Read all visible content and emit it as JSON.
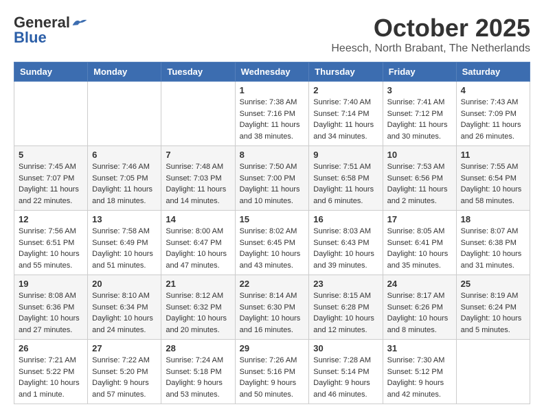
{
  "header": {
    "logo_general": "General",
    "logo_blue": "Blue",
    "month_title": "October 2025",
    "location": "Heesch, North Brabant, The Netherlands"
  },
  "weekdays": [
    "Sunday",
    "Monday",
    "Tuesday",
    "Wednesday",
    "Thursday",
    "Friday",
    "Saturday"
  ],
  "weeks": [
    [
      {
        "day": "",
        "sunrise": "",
        "sunset": "",
        "daylight": ""
      },
      {
        "day": "",
        "sunrise": "",
        "sunset": "",
        "daylight": ""
      },
      {
        "day": "",
        "sunrise": "",
        "sunset": "",
        "daylight": ""
      },
      {
        "day": "1",
        "sunrise": "Sunrise: 7:38 AM",
        "sunset": "Sunset: 7:16 PM",
        "daylight": "Daylight: 11 hours and 38 minutes."
      },
      {
        "day": "2",
        "sunrise": "Sunrise: 7:40 AM",
        "sunset": "Sunset: 7:14 PM",
        "daylight": "Daylight: 11 hours and 34 minutes."
      },
      {
        "day": "3",
        "sunrise": "Sunrise: 7:41 AM",
        "sunset": "Sunset: 7:12 PM",
        "daylight": "Daylight: 11 hours and 30 minutes."
      },
      {
        "day": "4",
        "sunrise": "Sunrise: 7:43 AM",
        "sunset": "Sunset: 7:09 PM",
        "daylight": "Daylight: 11 hours and 26 minutes."
      }
    ],
    [
      {
        "day": "5",
        "sunrise": "Sunrise: 7:45 AM",
        "sunset": "Sunset: 7:07 PM",
        "daylight": "Daylight: 11 hours and 22 minutes."
      },
      {
        "day": "6",
        "sunrise": "Sunrise: 7:46 AM",
        "sunset": "Sunset: 7:05 PM",
        "daylight": "Daylight: 11 hours and 18 minutes."
      },
      {
        "day": "7",
        "sunrise": "Sunrise: 7:48 AM",
        "sunset": "Sunset: 7:03 PM",
        "daylight": "Daylight: 11 hours and 14 minutes."
      },
      {
        "day": "8",
        "sunrise": "Sunrise: 7:50 AM",
        "sunset": "Sunset: 7:00 PM",
        "daylight": "Daylight: 11 hours and 10 minutes."
      },
      {
        "day": "9",
        "sunrise": "Sunrise: 7:51 AM",
        "sunset": "Sunset: 6:58 PM",
        "daylight": "Daylight: 11 hours and 6 minutes."
      },
      {
        "day": "10",
        "sunrise": "Sunrise: 7:53 AM",
        "sunset": "Sunset: 6:56 PM",
        "daylight": "Daylight: 11 hours and 2 minutes."
      },
      {
        "day": "11",
        "sunrise": "Sunrise: 7:55 AM",
        "sunset": "Sunset: 6:54 PM",
        "daylight": "Daylight: 10 hours and 58 minutes."
      }
    ],
    [
      {
        "day": "12",
        "sunrise": "Sunrise: 7:56 AM",
        "sunset": "Sunset: 6:51 PM",
        "daylight": "Daylight: 10 hours and 55 minutes."
      },
      {
        "day": "13",
        "sunrise": "Sunrise: 7:58 AM",
        "sunset": "Sunset: 6:49 PM",
        "daylight": "Daylight: 10 hours and 51 minutes."
      },
      {
        "day": "14",
        "sunrise": "Sunrise: 8:00 AM",
        "sunset": "Sunset: 6:47 PM",
        "daylight": "Daylight: 10 hours and 47 minutes."
      },
      {
        "day": "15",
        "sunrise": "Sunrise: 8:02 AM",
        "sunset": "Sunset: 6:45 PM",
        "daylight": "Daylight: 10 hours and 43 minutes."
      },
      {
        "day": "16",
        "sunrise": "Sunrise: 8:03 AM",
        "sunset": "Sunset: 6:43 PM",
        "daylight": "Daylight: 10 hours and 39 minutes."
      },
      {
        "day": "17",
        "sunrise": "Sunrise: 8:05 AM",
        "sunset": "Sunset: 6:41 PM",
        "daylight": "Daylight: 10 hours and 35 minutes."
      },
      {
        "day": "18",
        "sunrise": "Sunrise: 8:07 AM",
        "sunset": "Sunset: 6:38 PM",
        "daylight": "Daylight: 10 hours and 31 minutes."
      }
    ],
    [
      {
        "day": "19",
        "sunrise": "Sunrise: 8:08 AM",
        "sunset": "Sunset: 6:36 PM",
        "daylight": "Daylight: 10 hours and 27 minutes."
      },
      {
        "day": "20",
        "sunrise": "Sunrise: 8:10 AM",
        "sunset": "Sunset: 6:34 PM",
        "daylight": "Daylight: 10 hours and 24 minutes."
      },
      {
        "day": "21",
        "sunrise": "Sunrise: 8:12 AM",
        "sunset": "Sunset: 6:32 PM",
        "daylight": "Daylight: 10 hours and 20 minutes."
      },
      {
        "day": "22",
        "sunrise": "Sunrise: 8:14 AM",
        "sunset": "Sunset: 6:30 PM",
        "daylight": "Daylight: 10 hours and 16 minutes."
      },
      {
        "day": "23",
        "sunrise": "Sunrise: 8:15 AM",
        "sunset": "Sunset: 6:28 PM",
        "daylight": "Daylight: 10 hours and 12 minutes."
      },
      {
        "day": "24",
        "sunrise": "Sunrise: 8:17 AM",
        "sunset": "Sunset: 6:26 PM",
        "daylight": "Daylight: 10 hours and 8 minutes."
      },
      {
        "day": "25",
        "sunrise": "Sunrise: 8:19 AM",
        "sunset": "Sunset: 6:24 PM",
        "daylight": "Daylight: 10 hours and 5 minutes."
      }
    ],
    [
      {
        "day": "26",
        "sunrise": "Sunrise: 7:21 AM",
        "sunset": "Sunset: 5:22 PM",
        "daylight": "Daylight: 10 hours and 1 minute."
      },
      {
        "day": "27",
        "sunrise": "Sunrise: 7:22 AM",
        "sunset": "Sunset: 5:20 PM",
        "daylight": "Daylight: 9 hours and 57 minutes."
      },
      {
        "day": "28",
        "sunrise": "Sunrise: 7:24 AM",
        "sunset": "Sunset: 5:18 PM",
        "daylight": "Daylight: 9 hours and 53 minutes."
      },
      {
        "day": "29",
        "sunrise": "Sunrise: 7:26 AM",
        "sunset": "Sunset: 5:16 PM",
        "daylight": "Daylight: 9 hours and 50 minutes."
      },
      {
        "day": "30",
        "sunrise": "Sunrise: 7:28 AM",
        "sunset": "Sunset: 5:14 PM",
        "daylight": "Daylight: 9 hours and 46 minutes."
      },
      {
        "day": "31",
        "sunrise": "Sunrise: 7:30 AM",
        "sunset": "Sunset: 5:12 PM",
        "daylight": "Daylight: 9 hours and 42 minutes."
      },
      {
        "day": "",
        "sunrise": "",
        "sunset": "",
        "daylight": ""
      }
    ]
  ]
}
